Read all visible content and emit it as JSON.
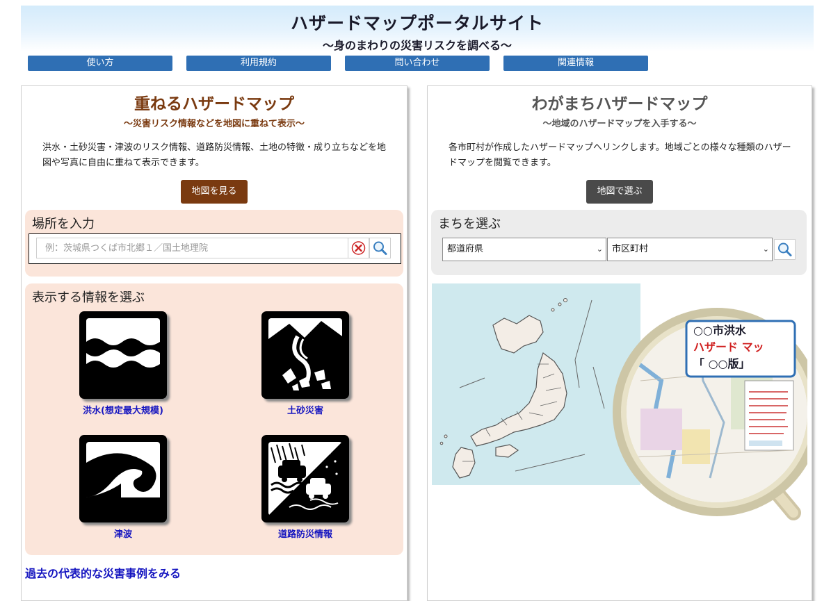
{
  "header": {
    "title": "ハザードマップポータルサイト",
    "subtitle": "～身のまわりの災害リスクを調べる～"
  },
  "nav": [
    {
      "label": "使い方"
    },
    {
      "label": "利用規約"
    },
    {
      "label": "問い合わせ"
    },
    {
      "label": "関連情報"
    }
  ],
  "left": {
    "title": "重ねるハザードマップ",
    "subtitle": "～災害リスク情報などを地図に重ねて表示～",
    "description": "洪水・土砂災害・津波のリスク情報、道路防災情報、土地の特徴・成り立ちなどを地図や写真に自由に重ねて表示できます。",
    "button": "地図を見る",
    "location": {
      "heading": "場所を入力",
      "placeholder": "例：茨城県つくば市北郷１／国土地理院"
    },
    "info": {
      "heading": "表示する情報を選ぶ",
      "items": [
        {
          "label": "洪水(想定最大規模)",
          "icon": "flood-icon"
        },
        {
          "label": "土砂災害",
          "icon": "landslide-icon"
        },
        {
          "label": "津波",
          "icon": "tsunami-icon"
        },
        {
          "label": "道路防災情報",
          "icon": "road-disaster-icon"
        }
      ]
    },
    "past_link": "過去の代表的な災害事例をみる"
  },
  "right": {
    "title": "わがまちハザードマップ",
    "subtitle": "～地域のハザードマップを入手する～",
    "description": "各市町村が作成したハザードマップへリンクします。地域ごとの様々な種類のハザードマップを閲覧できます。",
    "button": "地図で選ぶ",
    "town": {
      "heading": "まちを選ぶ",
      "prefecture": "都道府県",
      "city": "市区町村"
    },
    "illustration": {
      "line1": "○○市洪水",
      "line2": "ハザード マッ",
      "line3": "「 ○○版」"
    }
  },
  "colors": {
    "nav_blue": "#2f6fb4",
    "left_brown": "#7a3a10",
    "left_box": "#fbe5da",
    "right_gray": "#555555",
    "right_box": "#ececec",
    "link_blue": "#1515c0"
  }
}
